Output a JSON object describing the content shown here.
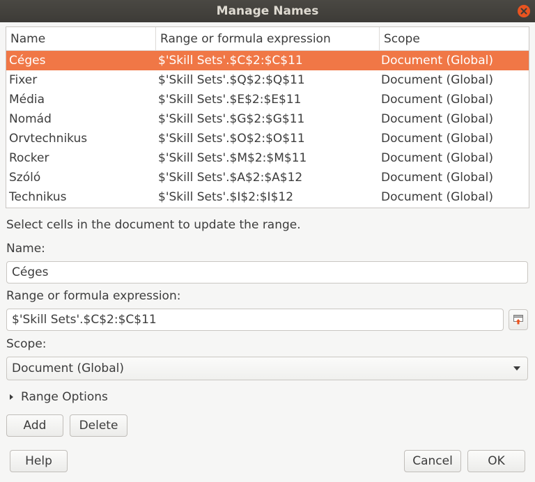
{
  "window": {
    "title": "Manage Names"
  },
  "table": {
    "headers": [
      "Name",
      "Range or formula expression",
      "Scope"
    ],
    "rows": [
      {
        "name": "Céges",
        "range": "$'Skill Sets'.$C$2:$C$11",
        "scope": "Document (Global)",
        "selected": true
      },
      {
        "name": "Fixer",
        "range": "$'Skill Sets'.$Q$2:$Q$11",
        "scope": "Document (Global)"
      },
      {
        "name": "Média",
        "range": "$'Skill Sets'.$E$2:$E$11",
        "scope": "Document (Global)"
      },
      {
        "name": "Nomád",
        "range": "$'Skill Sets'.$G$2:$G$11",
        "scope": "Document (Global)"
      },
      {
        "name": "Orvtechnikus",
        "range": "$'Skill Sets'.$O$2:$O$11",
        "scope": "Document (Global)"
      },
      {
        "name": "Rocker",
        "range": "$'Skill Sets'.$M$2:$M$11",
        "scope": "Document (Global)"
      },
      {
        "name": "Szóló",
        "range": "$'Skill Sets'.$A$2:$A$12",
        "scope": "Document (Global)"
      },
      {
        "name": "Technikus",
        "range": "$'Skill Sets'.$I$2:$I$12",
        "scope": "Document (Global)"
      }
    ]
  },
  "info_text": "Select cells in the document to update the range.",
  "name_field": {
    "label": "Name:",
    "value": "Céges"
  },
  "range_field": {
    "label": "Range or formula expression:",
    "value": "$'Skill Sets'.$C$2:$C$11"
  },
  "scope_field": {
    "label": "Scope:",
    "value": "Document (Global)"
  },
  "range_options": {
    "label": "Range Options"
  },
  "buttons": {
    "add": "Add",
    "delete": "Delete",
    "help": "Help",
    "cancel": "Cancel",
    "ok": "OK"
  },
  "colors": {
    "selection": "#f07746",
    "titlebar": "#3d3b37",
    "close": "#e95420"
  },
  "icons": {
    "close": "close-icon",
    "shrink": "shrink-range-icon",
    "dropdown": "chevron-down-icon",
    "expander": "triangle-right-icon"
  }
}
